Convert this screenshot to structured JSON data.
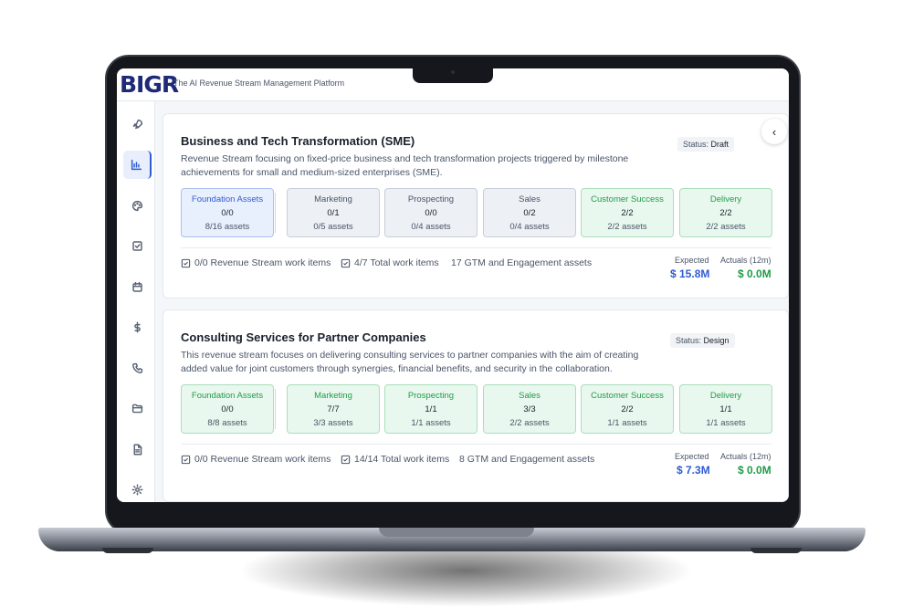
{
  "app": {
    "logo": "BIGR",
    "tagline": "The AI Revenue Stream Management Platform"
  },
  "sidebar": {
    "icons": [
      "rocket-icon",
      "chart-icon",
      "palette-icon",
      "checkbox-icon",
      "calendar-icon",
      "dollar-icon",
      "phone-icon",
      "folder-icon",
      "document-icon",
      "settings-icon"
    ],
    "active": "chart-icon"
  },
  "collapse_glyph": "‹",
  "streams": [
    {
      "title": "Business and Tech Transformation (SME)",
      "description": "Revenue Stream focusing on fixed-price business and tech transformation projects triggered by milestone achievements for small and medium-sized enterprises (SME).",
      "status_label": "Status:",
      "status_value": "Draft",
      "tiles": [
        {
          "name": "Foundation Assets",
          "value": "0/0",
          "assets": "8/16 assets",
          "tone": "blue"
        },
        {
          "name": "Marketing",
          "value": "0/1",
          "assets": "0/5 assets",
          "tone": "grey"
        },
        {
          "name": "Prospecting",
          "value": "0/0",
          "assets": "0/4 assets",
          "tone": "grey"
        },
        {
          "name": "Sales",
          "value": "0/2",
          "assets": "0/4 assets",
          "tone": "grey"
        },
        {
          "name": "Customer Success",
          "value": "2/2",
          "assets": "2/2 assets",
          "tone": "green"
        },
        {
          "name": "Delivery",
          "value": "2/2",
          "assets": "2/2 assets",
          "tone": "green"
        }
      ],
      "work_items": "0/0 Revenue Stream work items",
      "total_items": "4/7 Total work items",
      "gtm_assets": "17 GTM and Engagement assets",
      "expected_label": "Expected",
      "expected_value": "$ 15.8M",
      "actuals_label": "Actuals (12m)",
      "actuals_value": "$ 0.0M"
    },
    {
      "title": "Consulting Services for Partner Companies",
      "description": "This revenue stream focuses on delivering consulting services to partner companies with the aim of creating added value for joint customers through synergies, financial benefits, and security in the collaboration.",
      "status_label": "Status:",
      "status_value": "Design",
      "tiles": [
        {
          "name": "Foundation Assets",
          "value": "0/0",
          "assets": "8/8 assets",
          "tone": "green"
        },
        {
          "name": "Marketing",
          "value": "7/7",
          "assets": "3/3 assets",
          "tone": "green"
        },
        {
          "name": "Prospecting",
          "value": "1/1",
          "assets": "1/1 assets",
          "tone": "green"
        },
        {
          "name": "Sales",
          "value": "3/3",
          "assets": "2/2 assets",
          "tone": "green"
        },
        {
          "name": "Customer Success",
          "value": "2/2",
          "assets": "1/1 assets",
          "tone": "green"
        },
        {
          "name": "Delivery",
          "value": "1/1",
          "assets": "1/1 assets",
          "tone": "green"
        }
      ],
      "work_items": "0/0 Revenue Stream work items",
      "total_items": "14/14 Total work items",
      "gtm_assets": "8 GTM and Engagement assets",
      "expected_label": "Expected",
      "expected_value": "$ 7.3M",
      "actuals_label": "Actuals (12m)",
      "actuals_value": "$ 0.0M"
    }
  ]
}
